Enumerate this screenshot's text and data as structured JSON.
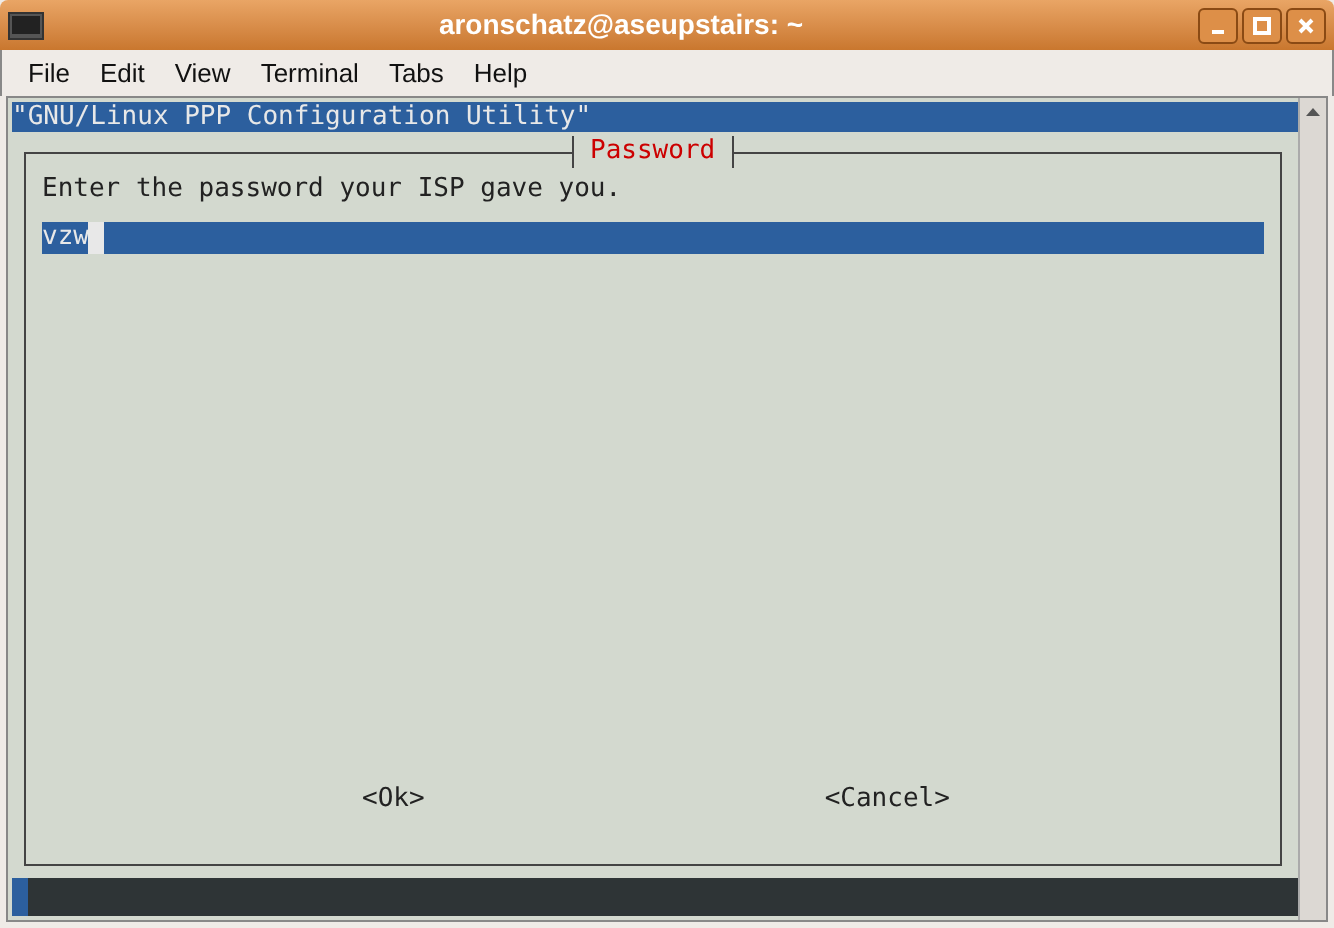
{
  "window": {
    "title": "aronschatz@aseupstairs: ~"
  },
  "menu": [
    {
      "label": "File"
    },
    {
      "label": "Edit"
    },
    {
      "label": "View"
    },
    {
      "label": "Terminal"
    },
    {
      "label": "Tabs"
    },
    {
      "label": "Help"
    }
  ],
  "backtitle": "\"GNU/Linux PPP Configuration Utility\"",
  "dialog": {
    "title": "Password",
    "prompt": "Enter the password your ISP gave you.",
    "input": {
      "value": "vzw"
    },
    "buttons": [
      {
        "label": "<Ok>",
        "selected": false
      },
      {
        "label": "<Cancel>",
        "selected": false
      }
    ]
  }
}
